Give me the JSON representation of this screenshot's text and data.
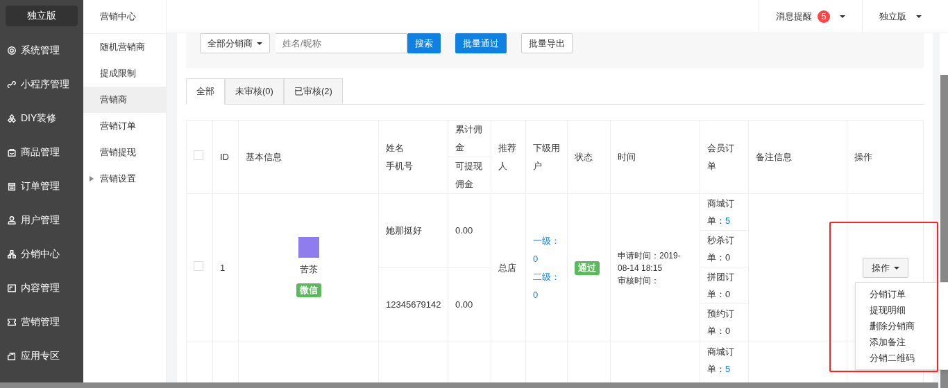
{
  "brand": "独立版",
  "nav": [
    {
      "label": "系统管理"
    },
    {
      "label": "小程序管理"
    },
    {
      "label": "DIY装修"
    },
    {
      "label": "商品管理"
    },
    {
      "label": "订单管理"
    },
    {
      "label": "用户管理"
    },
    {
      "label": "分销中心"
    },
    {
      "label": "内容管理"
    },
    {
      "label": "营销管理"
    },
    {
      "label": "应用专区"
    }
  ],
  "submenu": {
    "title": "营销中心",
    "items": [
      {
        "label": "随机营销商",
        "selected": false,
        "expandable": false
      },
      {
        "label": "提成限制",
        "selected": false,
        "expandable": false
      },
      {
        "label": "营销商",
        "selected": true,
        "expandable": false
      },
      {
        "label": "营销订单",
        "selected": false,
        "expandable": false
      },
      {
        "label": "营销提现",
        "selected": false,
        "expandable": false
      },
      {
        "label": "营销设置",
        "selected": false,
        "expandable": true
      }
    ]
  },
  "topbar": {
    "notifications": {
      "label": "消息提醒",
      "count": "5"
    },
    "account": "独立版"
  },
  "filters": {
    "dropdown": "全部分销商",
    "search_placeholder": "姓名/昵称",
    "buttons": [
      {
        "label": "搜索",
        "kind": "primary"
      },
      {
        "label": "批量通过",
        "kind": "primary"
      },
      {
        "label": "批量导出",
        "kind": "default"
      }
    ]
  },
  "tabs": [
    {
      "label": "全部",
      "selected": true
    },
    {
      "label": "未审核(0)",
      "selected": false
    },
    {
      "label": "已审核(2)",
      "selected": false
    }
  ],
  "table": {
    "header_checked": false,
    "columns": {
      "id": "ID",
      "basic": "基本信息",
      "name": "姓名",
      "phone": "手机号",
      "total": "累计佣金",
      "withdrawable": "可提现佣金",
      "referrer": "推荐人",
      "subordinates": "下级用户",
      "status": "状态",
      "time": "时间",
      "orders": "会员订单",
      "note": "备注信息",
      "actions": "操作"
    },
    "rows": [
      {
        "checked": false,
        "id": "1",
        "nickname": "苦茶",
        "source": "微信",
        "name": "她那挺好",
        "phone": "12345679142",
        "total": "0.00",
        "withdrawable": "0.00",
        "referrer": "总店",
        "subordinates": [
          {
            "label": "一级：0"
          },
          {
            "label": "二级：0"
          }
        ],
        "status": "通过",
        "apply_time": "申请时间：2019-08-14 18:15",
        "review_time": "审核时间：",
        "orders": [
          {
            "label": "商城订单：",
            "count": "5",
            "linked": true
          },
          {
            "label": "秒杀订单：",
            "count": "0",
            "linked": false
          },
          {
            "label": "拼团订单：",
            "count": "0",
            "linked": false
          },
          {
            "label": "预约订单：",
            "count": "0",
            "linked": false
          }
        ],
        "action": "操作"
      },
      {
        "orders": [
          {
            "label": "商城订单：",
            "count": "5",
            "linked": true
          }
        ]
      }
    ]
  },
  "action_menu": {
    "items": [
      {
        "label": "分销订单"
      },
      {
        "label": "提现明细"
      },
      {
        "label": "删除分销商"
      },
      {
        "label": "添加备注"
      },
      {
        "label": "分销二维码"
      }
    ]
  }
}
